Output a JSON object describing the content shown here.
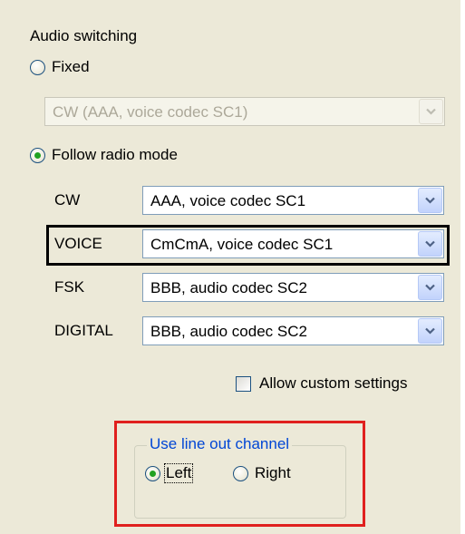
{
  "audio_switching": {
    "title": "Audio switching",
    "fixed": {
      "label": "Fixed",
      "selected": false,
      "combo_value": "CW (AAA, voice codec SC1)",
      "combo_enabled": false
    },
    "follow_radio_mode": {
      "label": "Follow radio mode",
      "selected": true
    },
    "modes": [
      {
        "label": "CW",
        "value": "AAA, voice codec SC1"
      },
      {
        "label": "VOICE",
        "value": "CmCmA, voice codec SC1"
      },
      {
        "label": "FSK",
        "value": "BBB, audio codec SC2"
      },
      {
        "label": "DIGITAL",
        "value": "BBB, audio codec SC2"
      }
    ],
    "allow_custom_settings": {
      "label": "Allow custom settings",
      "checked": false
    }
  },
  "line_out": {
    "caption": "Use line out channel",
    "left": {
      "label": "Left",
      "selected": true
    },
    "right": {
      "label": "Right",
      "selected": false
    }
  },
  "colors": {
    "panel_bg": "#ece9d8",
    "group_caption": "#0046d5",
    "highlight_box": "#e0201e",
    "selected_row_box": "#000000",
    "radio_dot": "#21a121"
  }
}
